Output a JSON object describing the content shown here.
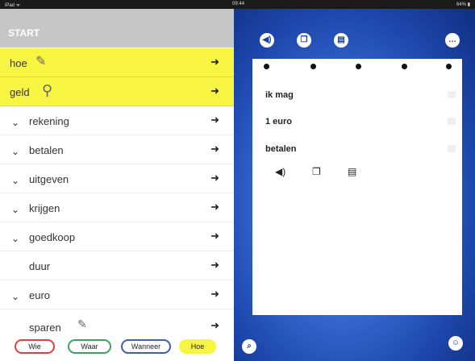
{
  "statusbar": {
    "left": "iPad ᯤ",
    "center": "09:44",
    "right": "64% ▮"
  },
  "left_panel": {
    "title": "START",
    "rows": [
      {
        "label": "hoe",
        "highlighted": true,
        "icon": "pencil-icon"
      },
      {
        "label": "geld",
        "highlighted": true,
        "icon": "coins-icon"
      },
      {
        "label": "rekening",
        "highlighted": false
      },
      {
        "label": "betalen",
        "highlighted": false
      },
      {
        "label": "uitgeven",
        "highlighted": false
      },
      {
        "label": "krijgen",
        "highlighted": false
      },
      {
        "label": "goedkoop",
        "highlighted": false
      },
      {
        "label": "duur",
        "highlighted": false,
        "no_chevron": true
      },
      {
        "label": "euro",
        "highlighted": false
      },
      {
        "label": "sparen",
        "highlighted": false
      }
    ],
    "arrow_glyph": "➜",
    "chevron_glyph": "⌄"
  },
  "tags": [
    {
      "label": "Wie",
      "color": "#e0413f"
    },
    {
      "label": "Waar",
      "color": "#3aa55a"
    },
    {
      "label": "Wanneer",
      "color": "#3e5fb8"
    },
    {
      "label": "Hoe",
      "color": "#f8f442"
    }
  ],
  "right_panel": {
    "toolbar": {
      "speaker_icon": "speaker-icon",
      "copy_icon": "copy-icon",
      "trash_icon": "trash-icon",
      "more_icon": "more-icon"
    },
    "sentence_items": [
      {
        "label": "ik mag"
      },
      {
        "label": "1 euro"
      },
      {
        "label": "betalen"
      }
    ],
    "bottom_left_icon": "zoom-icon",
    "bottom_right_icon": "robot-icon"
  }
}
